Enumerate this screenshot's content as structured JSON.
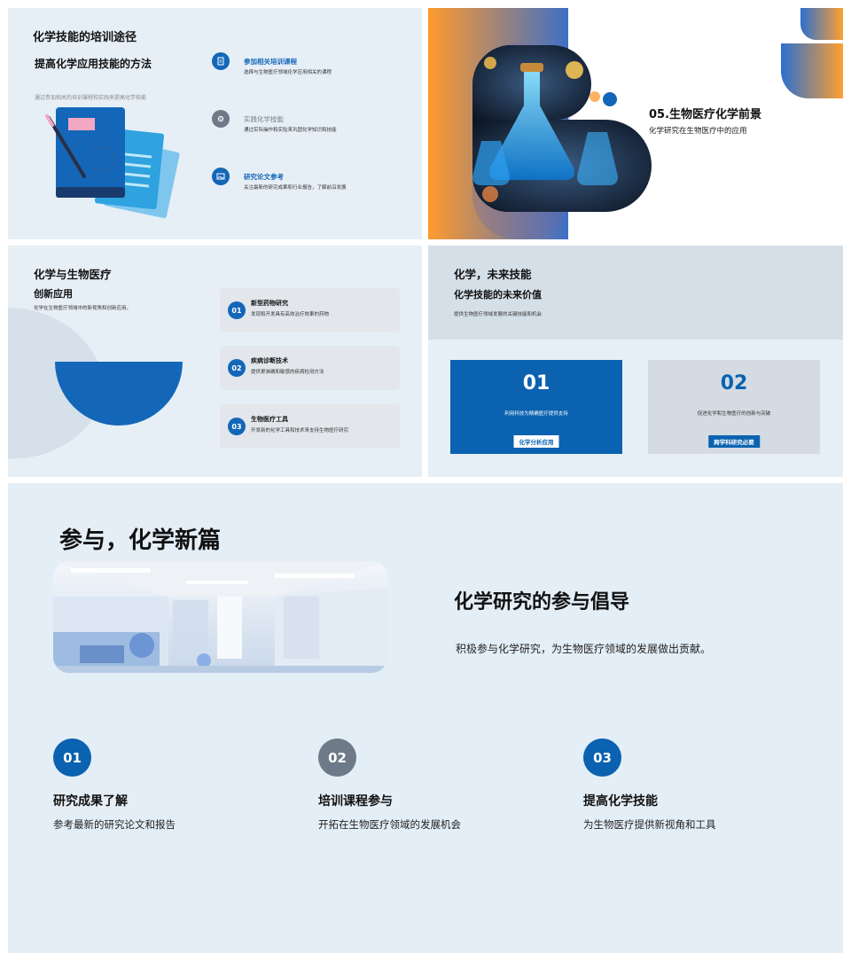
{
  "slide1": {
    "title": "化学技能的培训途径",
    "subtitle": "提高化学应用技能的方法",
    "caption": "通过参加相关的培训课程和实践来提高化学技能",
    "items": [
      {
        "icon": "document-icon",
        "title": "参加相关培训课程",
        "desc": "选择与生物医疗领域化学应用相关的课程"
      },
      {
        "icon": "settings-icon",
        "title": "实践化学技能",
        "desc": "通过实际操作和实验来巩固化学知识和技能"
      },
      {
        "icon": "image-icon",
        "title": "研究论文参考",
        "desc": "关注最新的研究成果和行业报告，了解前沿发展"
      }
    ]
  },
  "slide2": {
    "title": "05.生物医疗化学前景",
    "subtitle": "化学研究在生物医疗中的应用"
  },
  "slide3": {
    "title": "化学与生物医疗",
    "subtitle": "创新应用",
    "caption": "化学在生物医疗领域中的新视角和创新应用。",
    "cards": [
      {
        "num": "01",
        "title": "新型药物研究",
        "desc": "发现和开发具有高效治疗效果的药物"
      },
      {
        "num": "02",
        "title": "疾病诊断技术",
        "desc": "提供更准确和敏感的疾病检测方法"
      },
      {
        "num": "03",
        "title": "生物医疗工具",
        "desc": "开发新的化学工具和技术来支持生物医疗研究"
      }
    ]
  },
  "slide4": {
    "title": "化学，未来技能",
    "subtitle": "化学技能的未来价值",
    "caption": "提供生物医疗领域发展的关键技能和机会",
    "cards": [
      {
        "num": "01",
        "desc": "利用科技为精确医疗提供支持",
        "tag": "化学分析应用"
      },
      {
        "num": "02",
        "desc": "促进化学和生物医疗的创新与突破",
        "tag": "跨学科研究必要"
      }
    ]
  },
  "slide5": {
    "title": "参与，化学新篇",
    "heading": "化学研究的参与倡导",
    "paragraph": "积极参与化学研究，为生物医疗领域的发展做出贡献。",
    "steps": [
      {
        "num": "01",
        "title": "研究成果了解",
        "desc": "参考最新的研究论文和报告"
      },
      {
        "num": "02",
        "title": "培训课程参与",
        "desc": "开拓在生物医疗领域的发展机会"
      },
      {
        "num": "03",
        "title": "提高化学技能",
        "desc": "为生物医疗提供新视角和工具"
      }
    ]
  },
  "colors": {
    "primary": "#0a62b0",
    "gray": "#6f7a88",
    "orange": "#ff9a2e",
    "bg": "#e6eff6"
  }
}
